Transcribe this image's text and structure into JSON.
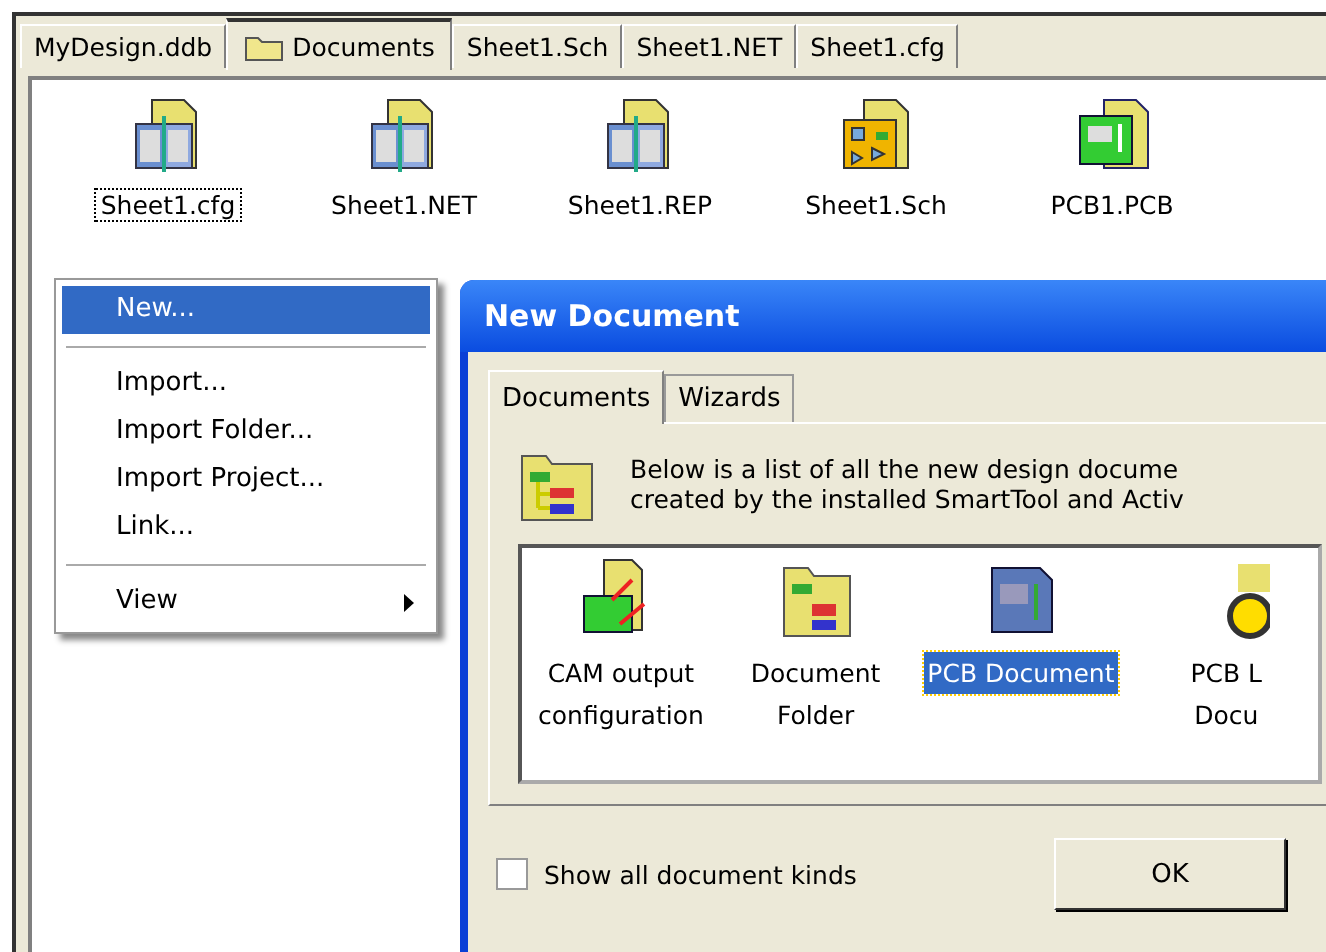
{
  "tabs": [
    {
      "label": "MyDesign.ddb",
      "selected": false,
      "icon": false
    },
    {
      "label": "Documents",
      "selected": true,
      "icon": true
    },
    {
      "label": "Sheet1.Sch",
      "selected": false,
      "icon": false
    },
    {
      "label": "Sheet1.NET",
      "selected": false,
      "icon": false
    },
    {
      "label": "Sheet1.cfg",
      "selected": false,
      "icon": false
    }
  ],
  "files": [
    {
      "name": "Sheet1.cfg",
      "kind": "book",
      "selected": true
    },
    {
      "name": "Sheet1.NET",
      "kind": "book",
      "selected": false
    },
    {
      "name": "Sheet1.REP",
      "kind": "book",
      "selected": false
    },
    {
      "name": "Sheet1.Sch",
      "kind": "schematic",
      "selected": false
    },
    {
      "name": "PCB1.PCB",
      "kind": "pcb",
      "selected": false
    }
  ],
  "context_menu": {
    "items": [
      {
        "kind": "item",
        "label": "New...",
        "selected": true,
        "submenu": false
      },
      {
        "kind": "separator"
      },
      {
        "kind": "item",
        "label": "Import...",
        "selected": false,
        "submenu": false
      },
      {
        "kind": "item",
        "label": "Import Folder...",
        "selected": false,
        "submenu": false
      },
      {
        "kind": "item",
        "label": "Import Project...",
        "selected": false,
        "submenu": false
      },
      {
        "kind": "item",
        "label": "Link...",
        "selected": false,
        "submenu": false
      },
      {
        "kind": "separator"
      },
      {
        "kind": "item",
        "label": "View",
        "selected": false,
        "submenu": true
      }
    ]
  },
  "dialog": {
    "title": "New Document",
    "tabs": [
      {
        "label": "Documents",
        "selected": true
      },
      {
        "label": "Wizards",
        "selected": false
      }
    ],
    "description": [
      "Below is a list of all the new design docume",
      "created by the installed SmartTool and Activ"
    ],
    "items": [
      {
        "lines": [
          "CAM output",
          "configuration"
        ],
        "kind": "cam",
        "selected": false
      },
      {
        "lines": [
          "Document",
          "Folder"
        ],
        "kind": "folder",
        "selected": false
      },
      {
        "lines": [
          "PCB Document"
        ],
        "kind": "pcb-blue",
        "selected": true
      },
      {
        "lines": [
          "PCB L",
          "Docu"
        ],
        "kind": "pcb-lib",
        "selected": false
      }
    ],
    "show_all": {
      "label": "Show all document kinds",
      "checked": false
    },
    "ok_button": "OK"
  }
}
